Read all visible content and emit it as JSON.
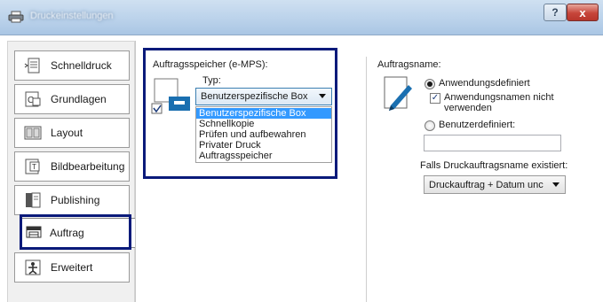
{
  "window": {
    "title": "Druckeinstellungen",
    "help_label": "?",
    "close_label": "x"
  },
  "sidebar": {
    "items": [
      {
        "label": "Schnelldruck",
        "icon": "quick-print-icon"
      },
      {
        "label": "Grundlagen",
        "icon": "basic-icon"
      },
      {
        "label": "Layout",
        "icon": "layout-icon"
      },
      {
        "label": "Bildbearbeitung",
        "icon": "imaging-icon"
      },
      {
        "label": "Publishing",
        "icon": "publishing-icon"
      },
      {
        "label": "Auftrag",
        "icon": "job-icon"
      },
      {
        "label": "Erweitert",
        "icon": "advanced-icon"
      }
    ],
    "active": "Auftrag"
  },
  "job_storage": {
    "section_label": "Auftragsspeicher (e-MPS):",
    "enabled": true,
    "type_label": "Typ:",
    "type_value": "Benutzerspezifische Box",
    "options": [
      "Benutzerspezifische Box",
      "Schnellkopie",
      "Prüfen und aufbewahren",
      "Privater Druck",
      "Auftragsspeicher"
    ],
    "selected_option": "Benutzerspezifische Box"
  },
  "job_name": {
    "section_label": "Auftragsname:",
    "app_defined_label": "Anwendungsdefiniert",
    "app_defined_selected": true,
    "no_app_name_label_1": "Anwendungsnamen nicht",
    "no_app_name_label_2": "verwenden",
    "no_app_name_checked": true,
    "user_defined_label": "Benutzerdefiniert:",
    "user_defined_selected": false,
    "user_defined_value": "",
    "exists_label": "Falls Druckauftragsname existiert:",
    "exists_value": "Druckauftrag + Datum unc"
  },
  "colors": {
    "highlight_border": "#0a1a7a",
    "selection": "#3399ff",
    "close_button": "#c7453a"
  }
}
